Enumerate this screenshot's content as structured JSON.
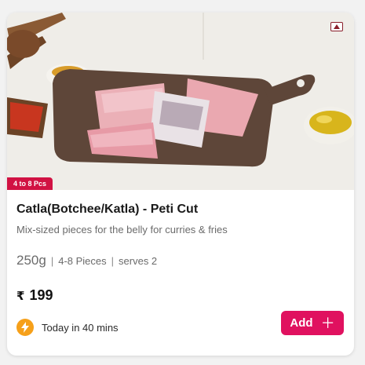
{
  "product": {
    "pieces_badge": "4 to 8 Pcs",
    "title": "Catla(Botchee/Katla) - Peti Cut",
    "description": "Mix-sized pieces for the belly for curries & fries",
    "weight": "250g",
    "pieces": "4-8 Pieces",
    "serves": "serves 2",
    "currency": "₹",
    "price": "199",
    "delivery": "Today in 40 mins",
    "add_label": "Add",
    "icons": {
      "veg": "non-veg-mark-icon",
      "delivery": "lightning-icon",
      "add": "plus-icon"
    },
    "colors": {
      "accent": "#e0115f",
      "badge": "#d11243",
      "bolt": "#f6a01a"
    }
  }
}
